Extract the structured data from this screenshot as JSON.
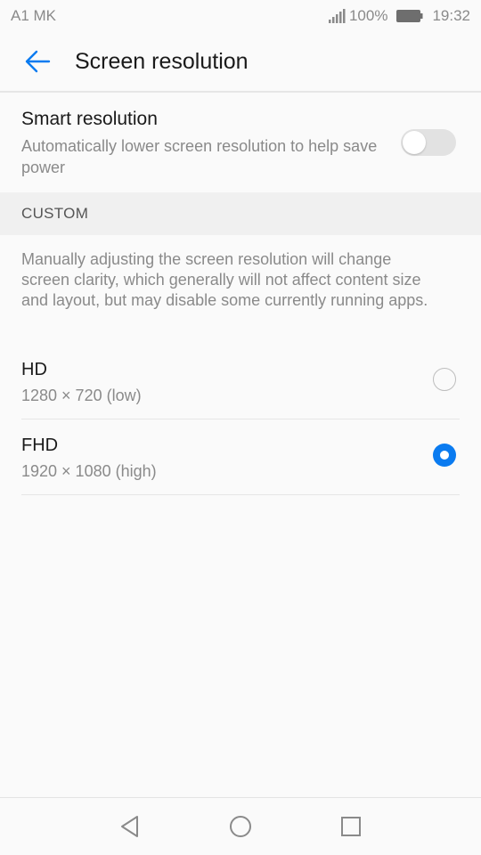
{
  "status_bar": {
    "carrier": "A1 MK",
    "battery": "100%",
    "time": "19:32",
    "icons": [
      "signal-icon",
      "battery-icon"
    ]
  },
  "header": {
    "back_icon": "arrow-left-icon",
    "title": "Screen resolution"
  },
  "smart_resolution": {
    "title": "Smart resolution",
    "description": "Automatically lower screen resolution to help save power",
    "enabled": false
  },
  "custom": {
    "section_label": "CUSTOM",
    "description": "Manually adjusting the screen resolution will change screen clarity, which generally will not affect content size and layout, but may disable some currently running apps.",
    "options": [
      {
        "label": "HD",
        "resolution": "1280 × 720 (low)",
        "selected": false
      },
      {
        "label": "FHD",
        "resolution": "1920 × 1080 (high)",
        "selected": true
      }
    ]
  },
  "nav_bar": {
    "icons": [
      "back-triangle-icon",
      "home-circle-icon",
      "recents-square-icon"
    ]
  },
  "colors": {
    "accent": "#0a7bf0",
    "text_primary": "#1a1a1a",
    "text_secondary": "#8a8a8a",
    "background": "#fafafa",
    "section_bg": "#f0f0f0"
  }
}
